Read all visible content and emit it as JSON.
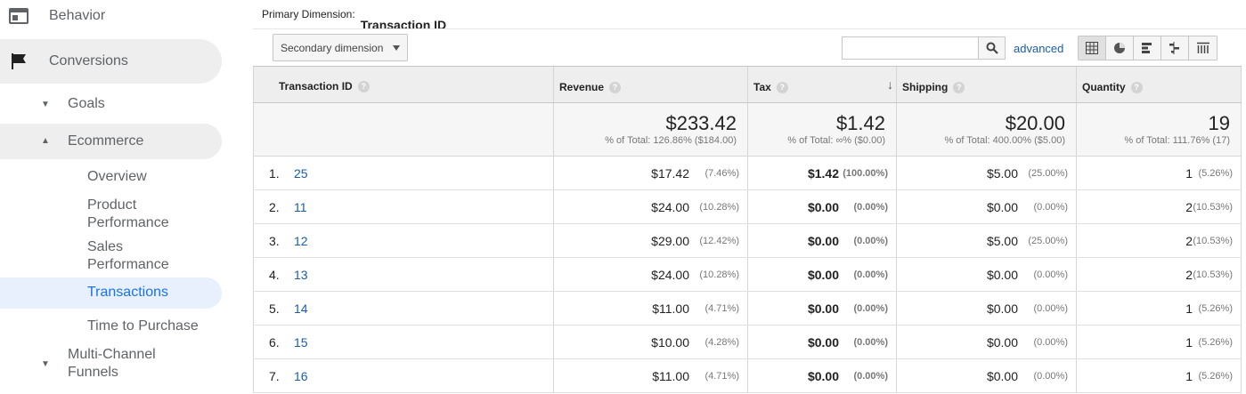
{
  "sidebar": {
    "behavior": "Behavior",
    "conversions": "Conversions",
    "goals": "Goals",
    "ecommerce": "Ecommerce",
    "overview": "Overview",
    "product_performance_1": "Product",
    "product_performance_2": "Performance",
    "sales_performance_1": "Sales",
    "sales_performance_2": "Performance",
    "transactions": "Transactions",
    "time_to_purchase": "Time to Purchase",
    "multichannel_1": "Multi-Channel",
    "multichannel_2": "Funnels"
  },
  "toolbar": {
    "primary_dimension_label": "Primary Dimension:",
    "primary_dimension_value": "Transaction ID",
    "secondary_dimension": "Secondary dimension",
    "search_value": "",
    "advanced": "advanced"
  },
  "table": {
    "headers": {
      "transaction_id": "Transaction ID",
      "revenue": "Revenue",
      "tax": "Tax",
      "shipping": "Shipping",
      "quantity": "Quantity"
    },
    "totals": {
      "revenue": "$233.42",
      "revenue_sub": "% of Total: 126.86% ($184.00)",
      "tax": "$1.42",
      "tax_sub": "% of Total: ∞% ($0.00)",
      "shipping": "$20.00",
      "shipping_sub": "% of Total: 400.00% ($5.00)",
      "quantity": "19",
      "quantity_sub": "% of Total: 111.76% (17)"
    },
    "rows": [
      {
        "rank": "1.",
        "id": "25",
        "revenue": "$17.42",
        "revenue_pct": "(7.46%)",
        "tax": "$1.42",
        "tax_pct": "(100.00%)",
        "shipping": "$5.00",
        "shipping_pct": "(25.00%)",
        "quantity": "1",
        "quantity_pct": "(5.26%)"
      },
      {
        "rank": "2.",
        "id": "11",
        "revenue": "$24.00",
        "revenue_pct": "(10.28%)",
        "tax": "$0.00",
        "tax_pct": "(0.00%)",
        "shipping": "$0.00",
        "shipping_pct": "(0.00%)",
        "quantity": "2",
        "quantity_pct": "(10.53%)"
      },
      {
        "rank": "3.",
        "id": "12",
        "revenue": "$29.00",
        "revenue_pct": "(12.42%)",
        "tax": "$0.00",
        "tax_pct": "(0.00%)",
        "shipping": "$5.00",
        "shipping_pct": "(25.00%)",
        "quantity": "2",
        "quantity_pct": "(10.53%)"
      },
      {
        "rank": "4.",
        "id": "13",
        "revenue": "$24.00",
        "revenue_pct": "(10.28%)",
        "tax": "$0.00",
        "tax_pct": "(0.00%)",
        "shipping": "$0.00",
        "shipping_pct": "(0.00%)",
        "quantity": "2",
        "quantity_pct": "(10.53%)"
      },
      {
        "rank": "5.",
        "id": "14",
        "revenue": "$11.00",
        "revenue_pct": "(4.71%)",
        "tax": "$0.00",
        "tax_pct": "(0.00%)",
        "shipping": "$0.00",
        "shipping_pct": "(0.00%)",
        "quantity": "1",
        "quantity_pct": "(5.26%)"
      },
      {
        "rank": "6.",
        "id": "15",
        "revenue": "$10.00",
        "revenue_pct": "(4.28%)",
        "tax": "$0.00",
        "tax_pct": "(0.00%)",
        "shipping": "$0.00",
        "shipping_pct": "(0.00%)",
        "quantity": "1",
        "quantity_pct": "(5.26%)"
      },
      {
        "rank": "7.",
        "id": "16",
        "revenue": "$11.00",
        "revenue_pct": "(4.71%)",
        "tax": "$0.00",
        "tax_pct": "(0.00%)",
        "shipping": "$0.00",
        "shipping_pct": "(0.00%)",
        "quantity": "1",
        "quantity_pct": "(5.26%)"
      }
    ]
  },
  "colors": {
    "link": "#1a5ea8",
    "active_nav": "#1a73e8",
    "active_nav_bg": "#e8f0fe",
    "nav_pill_bg": "#eeeeee"
  }
}
